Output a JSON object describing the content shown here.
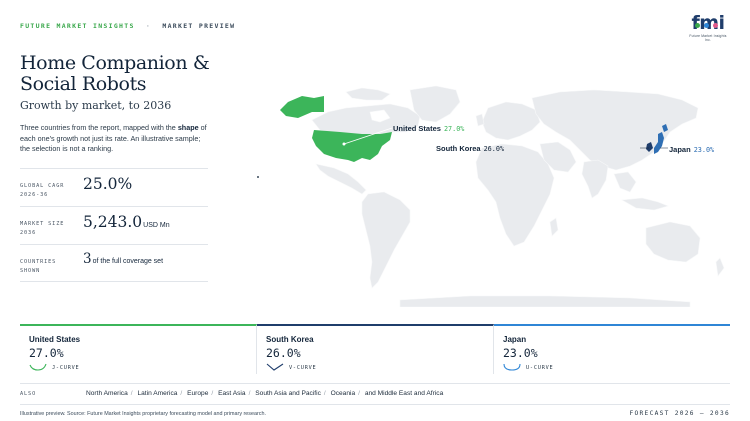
{
  "header": {
    "brand": "FUTURE MARKET INSIGHTS",
    "separator": "·",
    "section": "MARKET PREVIEW",
    "logo_text": "fmi",
    "logo_subtext": "Future Market Insights Inc."
  },
  "title": "Home Companion & Social Robots",
  "subtitle": "Growth by market, to 2036",
  "description": {
    "part1": "Three countries from the report, mapped with the ",
    "bold": "shape",
    "part2": " of each one's growth not just its rate. An illustrative sample; the selection is not a ranking."
  },
  "stats": [
    {
      "label_line1": "GLOBAL CAGR",
      "label_line2": "2026-36",
      "value": "25.0%",
      "unit": ""
    },
    {
      "label_line1": "MARKET SIZE",
      "label_line2": "2036",
      "value": "5,243.0",
      "unit": "USD Mn"
    },
    {
      "label_line1": "COUNTRIES",
      "label_line2": "SHOWN",
      "value": "3",
      "unit": "of the full coverage set"
    }
  ],
  "map": {
    "callouts": [
      {
        "name": "United States",
        "value": "27.0%"
      },
      {
        "name": "South Korea",
        "value": "26.0%"
      },
      {
        "name": "Japan",
        "value": "23.0%"
      }
    ],
    "colors": {
      "land": "#e9ebee",
      "us": "#3cb55a",
      "asia": "#2f6fb4"
    }
  },
  "cards": [
    {
      "name": "United States",
      "value": "27.0%",
      "curve": "J-CURVE",
      "color": "#3cb55a",
      "curve_icon": "j-curve-icon"
    },
    {
      "name": "South Korea",
      "value": "26.0%",
      "curve": "V-CURVE",
      "color": "#1f3d6b",
      "curve_icon": "v-curve-icon"
    },
    {
      "name": "Japan",
      "value": "23.0%",
      "curve": "U-CURVE",
      "color": "#2f86d6",
      "curve_icon": "u-curve-icon"
    }
  ],
  "also": {
    "label": "ALSO",
    "regions": [
      "North America",
      "Latin America",
      "Europe",
      "East Asia",
      "South Asia and Pacific",
      "Oceania",
      "and Middle East and Africa"
    ]
  },
  "footer": {
    "source": "Illustrative preview. Source: Future Market Insights proprietary forecasting model and primary research.",
    "forecast": "FORECAST 2026 – 2036"
  }
}
